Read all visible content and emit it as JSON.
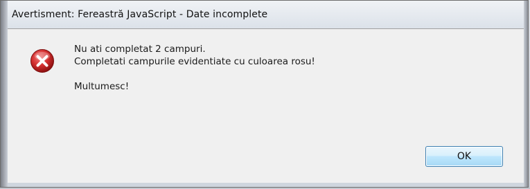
{
  "dialog": {
    "title": "Avertisment: Fereastră JavaScript - Date incomplete",
    "icon": "error-icon",
    "message_lines": [
      "Nu ati completat 2 campuri.",
      "Completati campurile evidentiate cu culoarea rosu!",
      "",
      "Multumesc!"
    ],
    "ok_label": "OK"
  },
  "colors": {
    "error_icon": "#d32f2f",
    "button_border": "#3c7fb1",
    "client_background": "#f0f0f0"
  }
}
